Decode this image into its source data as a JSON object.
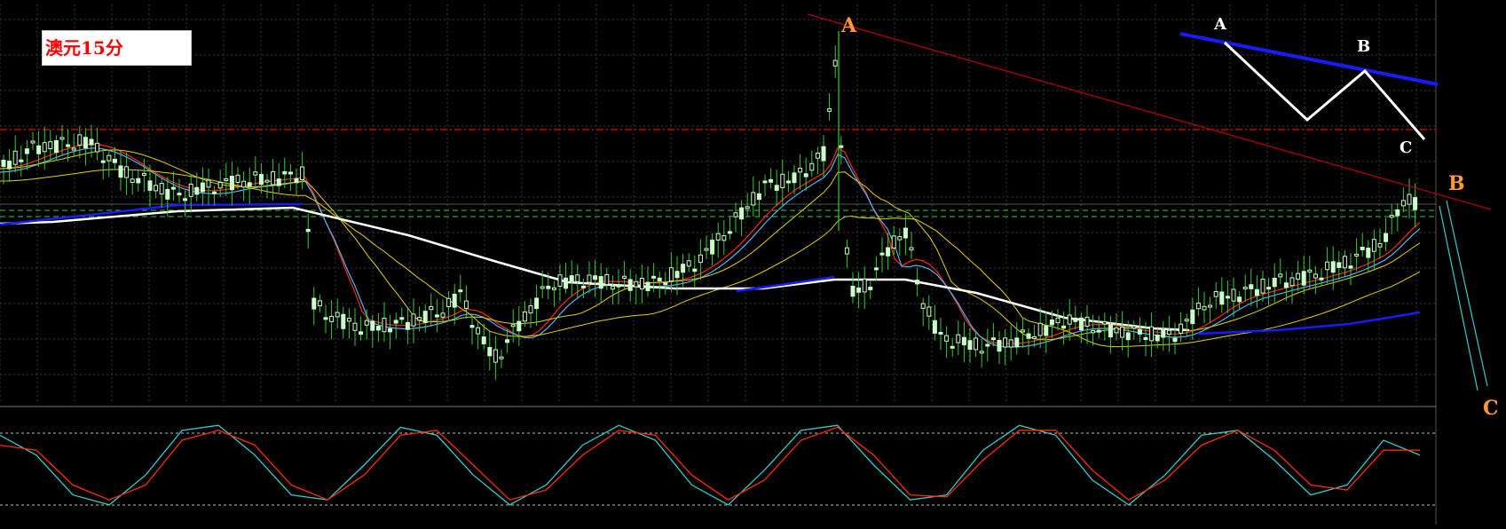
{
  "title": "澳元15分",
  "colors": {
    "background": "#000000",
    "grid": "#3a3a3a",
    "candle_up": "#ccffcc",
    "candle_wick": "#33cc33",
    "ma_fast_red": "#ff2a00",
    "ma_fast_blue": "#4fb3ff",
    "ma_yellow": "#e6d200",
    "ma_long_blue": "#1a1aff",
    "ma_long_white": "#ffffff",
    "resistance_red": "#cc0000",
    "support_green": "#33cc33",
    "trendline": "#b30000",
    "wave_label": "#ff9933",
    "stoch_k": "#33cccc",
    "stoch_d": "#ff2a00"
  },
  "annotations": {
    "wave_a": "A",
    "wave_b": "B",
    "wave_c": "C",
    "inset_a": "A",
    "inset_b": "B",
    "inset_c": "C"
  },
  "chart_data": [
    {
      "type": "line",
      "title": "澳元15分",
      "description_of_series": "price close path (candlesticks)",
      "x": [
        0,
        10,
        20,
        30,
        40,
        50,
        60,
        70,
        80,
        90,
        100,
        110,
        120,
        130,
        140,
        150,
        160,
        170,
        180,
        190,
        200,
        210,
        220,
        230,
        240,
        250,
        260,
        270,
        280,
        290,
        300,
        310,
        320,
        330,
        340,
        350,
        360,
        370,
        380,
        390
      ],
      "series": [
        {
          "values": [
            165,
            170,
            150,
            160,
            148,
            162,
            175,
            185,
            190,
            200,
            205,
            203,
            208,
            205,
            200,
            188,
            190,
            150,
            140,
            145,
            155,
            160,
            152,
            165,
            172,
            175,
            170,
            180,
            178,
            176,
            170,
            160,
            162,
            150,
            146,
            138,
            132,
            120,
            110,
            100
          ]
        }
      ],
      "grid": true,
      "legend": "none"
    },
    {
      "type": "line",
      "title": "",
      "description_of_series": "stochastic oscillator",
      "x": [
        0,
        1,
        2,
        3,
        4,
        5,
        6,
        7,
        8,
        9,
        10,
        11,
        12,
        13,
        14,
        15,
        16,
        17,
        18,
        19,
        20,
        21,
        22,
        23,
        24,
        25,
        26,
        27,
        28,
        29,
        30,
        31,
        32,
        33,
        34,
        35,
        36,
        37,
        38,
        39
      ],
      "series": [
        {
          "values": [
            80,
            60,
            20,
            10,
            40,
            85,
            90,
            60,
            20,
            15,
            50,
            88,
            80,
            40,
            10,
            30,
            70,
            90,
            75,
            30,
            10,
            45,
            85,
            90,
            50,
            15,
            20,
            65,
            90,
            80,
            35,
            10,
            40,
            80,
            85,
            55,
            20,
            30,
            75,
            60
          ]
        },
        {
          "values": [
            70,
            65,
            30,
            15,
            30,
            75,
            85,
            70,
            30,
            15,
            40,
            80,
            85,
            50,
            15,
            25,
            60,
            85,
            80,
            40,
            15,
            35,
            75,
            88,
            60,
            20,
            18,
            55,
            85,
            85,
            45,
            15,
            35,
            70,
            85,
            65,
            30,
            25,
            65,
            65
          ]
        }
      ],
      "ylim": [
        0,
        100
      ],
      "grid": false,
      "legend": "none"
    }
  ]
}
